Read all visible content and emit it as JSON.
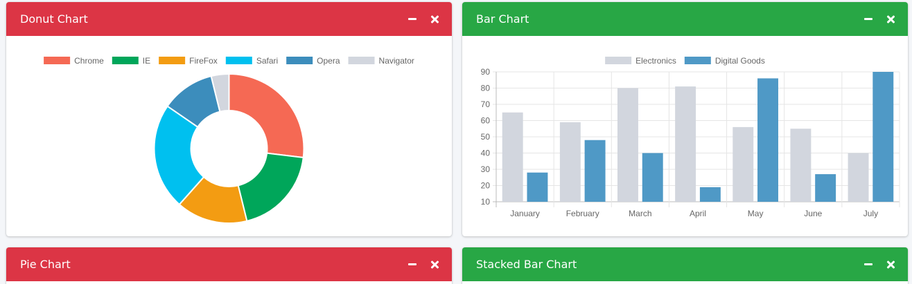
{
  "colors": {
    "danger": "#dc3545",
    "success": "#28a745"
  },
  "cards": {
    "donut": {
      "title": "Donut Chart"
    },
    "bar": {
      "title": "Bar Chart"
    },
    "pie": {
      "title": "Pie Chart"
    },
    "stacked": {
      "title": "Stacked Bar Chart"
    }
  },
  "chart_data": [
    {
      "type": "pie",
      "variant": "donut",
      "labels": [
        "Chrome",
        "IE",
        "FireFox",
        "Safari",
        "Opera",
        "Navigator"
      ],
      "values": [
        700,
        500,
        400,
        600,
        300,
        100
      ],
      "colors": [
        "#f56954",
        "#00a65a",
        "#f39c12",
        "#00c0ef",
        "#3c8dbc",
        "#d2d6de"
      ],
      "legend": "top"
    },
    {
      "type": "bar",
      "categories": [
        "January",
        "February",
        "March",
        "April",
        "May",
        "June",
        "July"
      ],
      "series": [
        {
          "name": "Electronics",
          "values": [
            65,
            59,
            80,
            81,
            56,
            55,
            40
          ],
          "color": "#d2d6de"
        },
        {
          "name": "Digital Goods",
          "values": [
            28,
            48,
            40,
            19,
            86,
            27,
            90
          ],
          "color": "#4f99c6"
        }
      ],
      "ylim": [
        10,
        90
      ],
      "yticks": [
        10,
        20,
        30,
        40,
        50,
        60,
        70,
        80,
        90
      ],
      "grid": true,
      "legend": "top"
    }
  ]
}
